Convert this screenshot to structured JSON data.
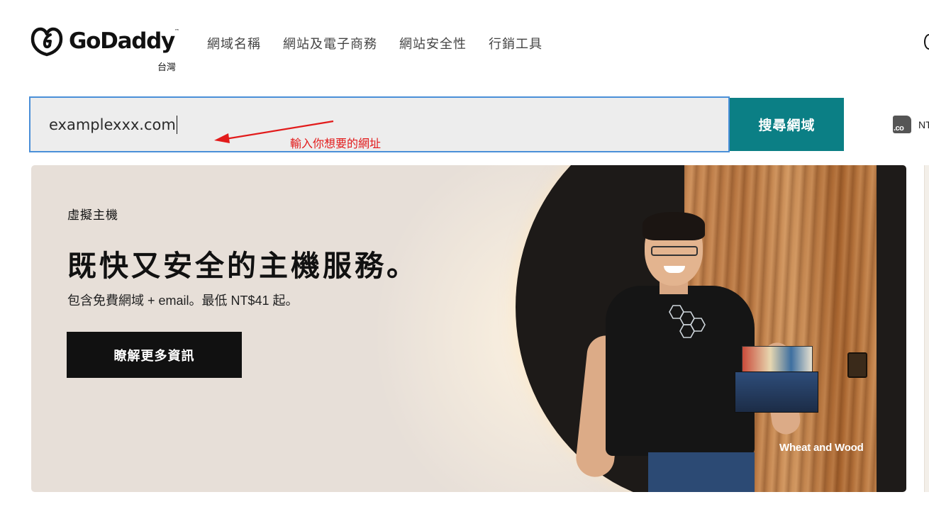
{
  "header": {
    "logo_text": "GoDaddy",
    "logo_tm": "™",
    "region": "台灣",
    "nav": [
      {
        "label": "網域名稱"
      },
      {
        "label": "網站及電子商務"
      },
      {
        "label": "網站安全性"
      },
      {
        "label": "行銷工具"
      }
    ]
  },
  "search": {
    "value": "examplexxx.com",
    "button_label": "搜尋網域",
    "tld_icon_text": ".co",
    "tld_text": "NT"
  },
  "annotation": {
    "label": "輸入你想要的網址",
    "color": "#e21b1b"
  },
  "hero": {
    "eyebrow": "虛擬主機",
    "title": "既快又安全的主機服務。",
    "subtitle": "包含免費網域 + email。最低 NT$41 起。",
    "cta_label": "瞭解更多資訊",
    "photo_credit": "Wheat and Wood"
  },
  "colors": {
    "search_button": "#0b7f85",
    "search_border": "#4a8fd8",
    "hero_background": "#e7dfd8",
    "cta_background": "#111111"
  }
}
